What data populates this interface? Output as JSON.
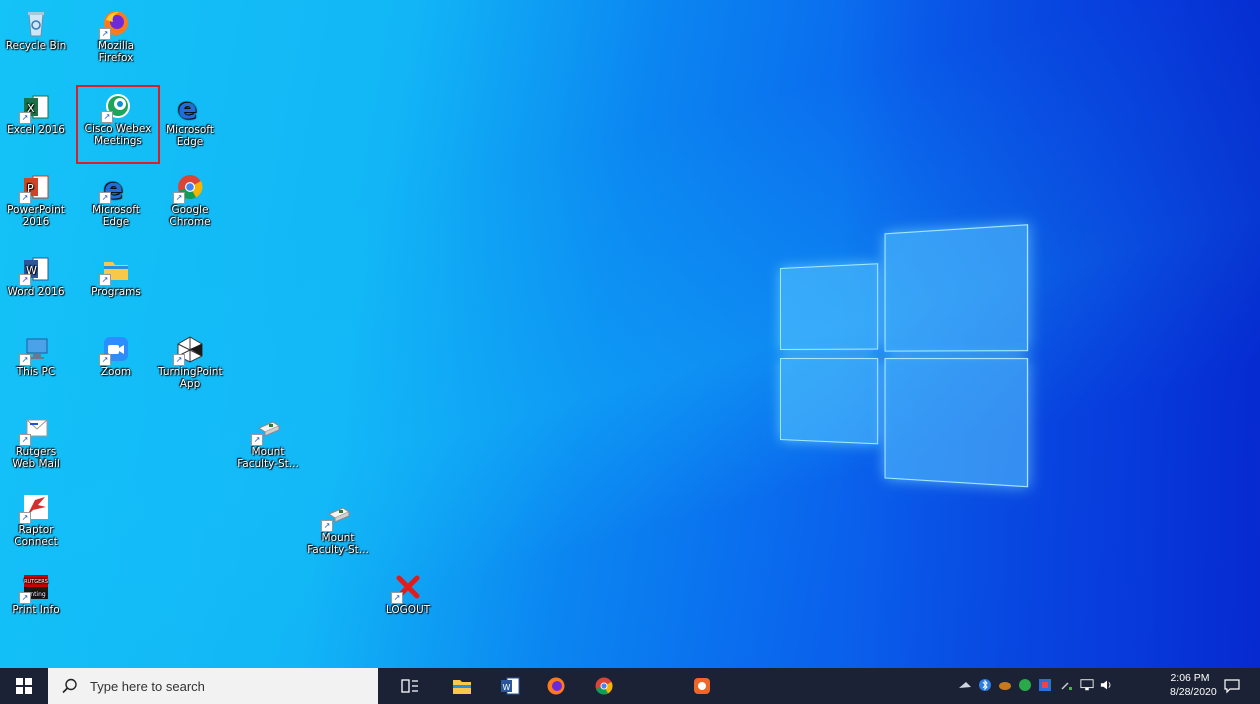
{
  "desktop": {
    "icons": {
      "recycle_bin": "Recycle Bin",
      "firefox": "Mozilla Firefox",
      "excel": "Excel 2016",
      "webex": "Cisco Webex Meetings",
      "edge1": "Microsoft Edge",
      "powerpoint": "PowerPoint 2016",
      "edge2": "Microsoft Edge",
      "chrome": "Google Chrome",
      "word": "Word 2016",
      "programs": "Programs",
      "this_pc": "This PC",
      "zoom": "Zoom",
      "turningpoint": "TurningPoint App",
      "rutgers_mail": "Rutgers Web Mail",
      "mount1": "Mount Faculty-St...",
      "raptor": "Raptor Connect",
      "mount2": "Mount Faculty-St...",
      "print_info": "Print Info",
      "print_info_badge": "RUTGERS",
      "print_info_badge2": "nting",
      "logout": "LOGOUT"
    },
    "selected_icon": "webex",
    "highlight_color": "#d6202a"
  },
  "taskbar": {
    "search_placeholder": "Type here to search",
    "clock_time": "2:06 PM",
    "clock_date": "8/28/2020"
  }
}
